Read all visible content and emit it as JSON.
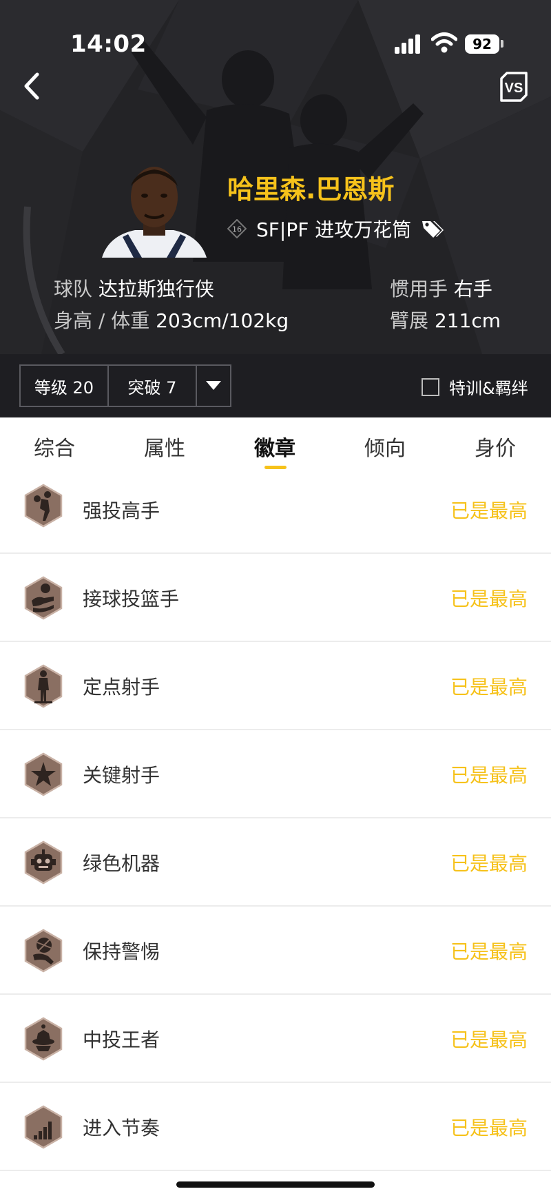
{
  "status_bar": {
    "time": "14:02",
    "battery": "92"
  },
  "header": {
    "player_name": "哈里森.巴恩斯",
    "rank_number": "16",
    "position_text": "SF|PF 进攻万花筒",
    "team_label": "球队",
    "team_value": "达拉斯独行侠",
    "body_label": "身高 / 体重",
    "body_value": "203cm/102kg",
    "hand_label": "惯用手",
    "hand_value": "右手",
    "wingspan_label": "臂展",
    "wingspan_value": "211cm"
  },
  "controls": {
    "level": "等级 20",
    "breakthrough": "突破 7",
    "special_training": "特训&羁绊",
    "special_training_checked": false
  },
  "tabs": [
    {
      "label": "综合",
      "active": false
    },
    {
      "label": "属性",
      "active": false
    },
    {
      "label": "徽章",
      "active": true
    },
    {
      "label": "倾向",
      "active": false
    },
    {
      "label": "身价",
      "active": false
    }
  ],
  "badges": [
    {
      "name": "强投高手",
      "status": "已是最高",
      "icon": "tough-shot-icon"
    },
    {
      "name": "接球投篮手",
      "status": "已是最高",
      "icon": "catch-and-shoot-icon"
    },
    {
      "name": "定点射手",
      "status": "已是最高",
      "icon": "spot-up-shooter-icon"
    },
    {
      "name": "关键射手",
      "status": "已是最高",
      "icon": "clutch-shooter-icon"
    },
    {
      "name": "绿色机器",
      "status": "已是最高",
      "icon": "green-machine-icon"
    },
    {
      "name": "保持警惕",
      "status": "已是最高",
      "icon": "stay-alert-icon"
    },
    {
      "name": "中投王者",
      "status": "已是最高",
      "icon": "mid-range-king-icon"
    },
    {
      "name": "进入节奏",
      "status": "已是最高",
      "icon": "in-rhythm-icon"
    }
  ],
  "colors": {
    "accent": "#f6c21b",
    "header_bg": "#232326",
    "badge_bronze": "#8a6f62"
  }
}
